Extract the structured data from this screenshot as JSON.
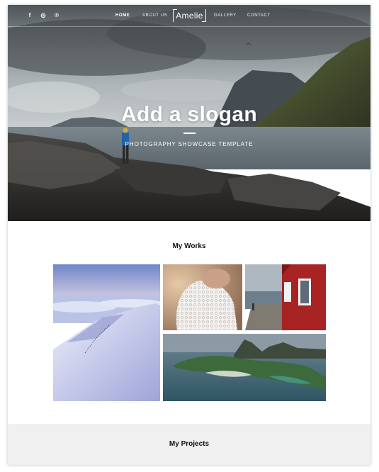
{
  "header": {
    "social_icons": [
      {
        "name": "facebook-icon",
        "glyph": "f"
      },
      {
        "name": "instagram-icon",
        "glyph": "◎"
      },
      {
        "name": "pinterest-icon",
        "glyph": "℗"
      }
    ],
    "nav": [
      {
        "label": "HOME",
        "active": true
      },
      {
        "label": "ABOUT US",
        "active": false
      },
      {
        "label": "GALLERY",
        "active": false
      },
      {
        "label": "CONTACT",
        "active": false
      }
    ],
    "logo": "Amelie"
  },
  "hero": {
    "title": "Add a slogan",
    "subtitle": "PHOTOGRAPHY SHOWCASE TEMPLATE"
  },
  "works": {
    "title": "My Works",
    "images": [
      {
        "name": "gallery-image-snowy-mountain"
      },
      {
        "name": "gallery-image-lace-dress"
      },
      {
        "name": "gallery-image-red-house-pier"
      },
      {
        "name": "gallery-image-aerial-islands"
      }
    ]
  },
  "projects": {
    "title": "My Projects"
  },
  "colors": {
    "text_dark": "#111111",
    "section_gray": "#f0f0f0",
    "hero_text": "#ffffff"
  }
}
